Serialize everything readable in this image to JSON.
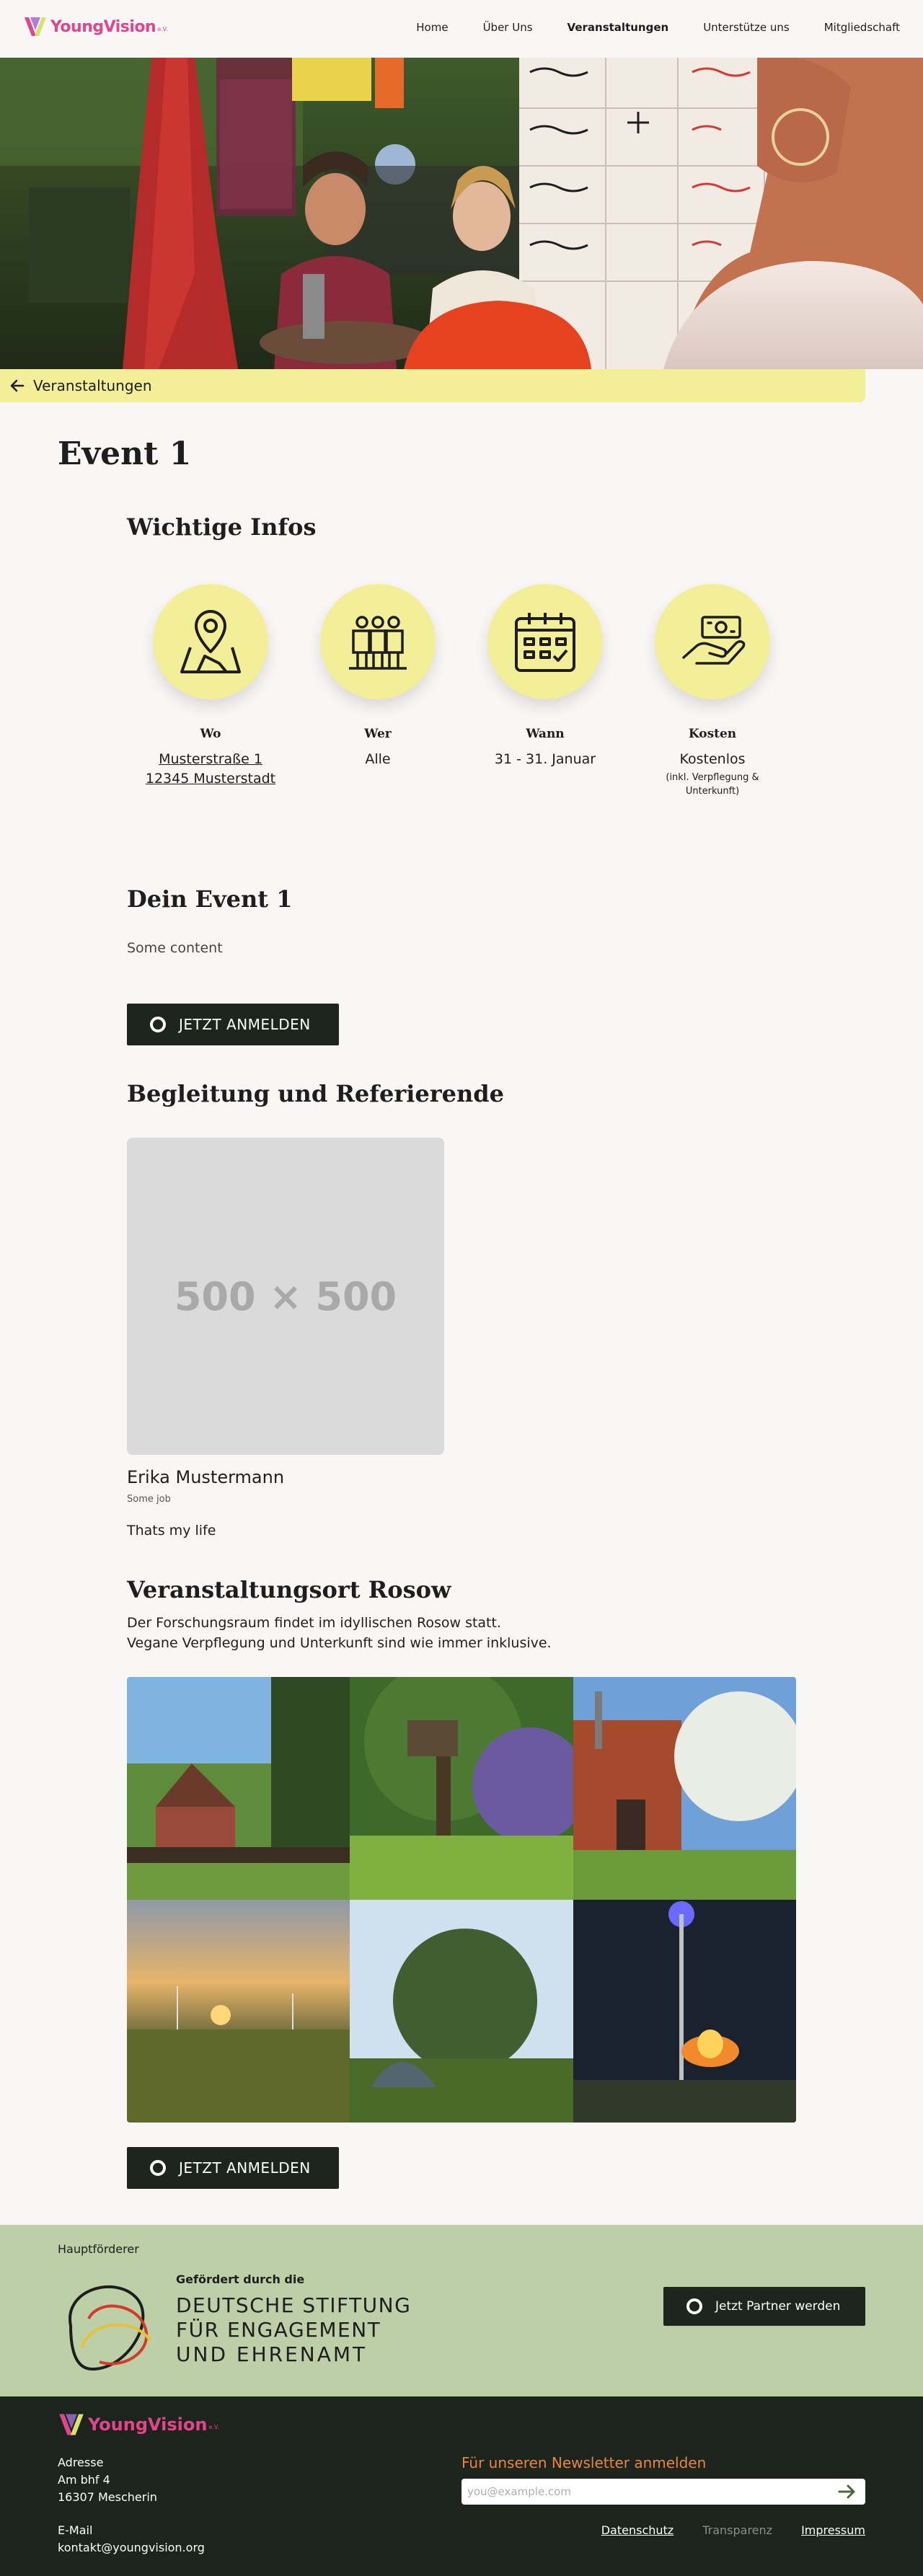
{
  "brand": {
    "name": "YoungVision",
    "suffix": "e.V."
  },
  "nav": {
    "items": [
      {
        "label": "Home"
      },
      {
        "label": "Über Uns"
      },
      {
        "label": "Veranstaltungen",
        "active": true
      },
      {
        "label": "Unterstütze uns"
      },
      {
        "label": "Mitgliedschaft"
      }
    ]
  },
  "back": {
    "label": "Veranstaltungen"
  },
  "page_title": "Event 1",
  "infos": {
    "heading": "Wichtige Infos",
    "items": [
      {
        "icon": "map-pin-icon",
        "title": "Wo",
        "value_line1": "Musterstraße 1",
        "value_line2": "12345 Musterstadt"
      },
      {
        "icon": "people-icon",
        "title": "Wer",
        "value": "Alle"
      },
      {
        "icon": "calendar-icon",
        "title": "Wann",
        "value": "31 - 31. Januar"
      },
      {
        "icon": "money-hand-icon",
        "title": "Kosten",
        "value": "Kostenlos",
        "note_line1": "(inkl. Verpflegung &",
        "note_line2": "Unterkunft)"
      }
    ]
  },
  "event": {
    "heading": "Dein Event 1",
    "content": "Some content"
  },
  "cta": {
    "label": "JETZT ANMELDEN"
  },
  "team": {
    "heading": "Begleitung und Referierende",
    "placeholder": "500 × 500",
    "person": {
      "name": "Erika Mustermann",
      "job": "Some job",
      "bio": "Thats my life"
    }
  },
  "venue": {
    "heading": "Veranstaltungsort Rosow",
    "line1": "Der Forschungsraum findet im idyllischen Rosow statt.",
    "line2": "Vegane Verpflegung und Unterkunft sind wie immer inklusive."
  },
  "sponsor": {
    "caption": "Hauptförderer",
    "small": "Gefördert durch die",
    "line1": "DEUTSCHE STIFTUNG",
    "line2": "FÜR ENGAGEMENT",
    "line3": "UND EHRENAMT",
    "partner_button": "Jetzt Partner werden"
  },
  "footer": {
    "address_label": "Adresse",
    "address_line1": "Am bhf 4",
    "address_line2": "16307 Mescherin",
    "email_label": "E-Mail",
    "email": "kontakt@youngvision.org",
    "newsletter_title": "Für unseren Newsletter anmelden",
    "newsletter_placeholder": "you@example.com",
    "links": [
      {
        "label": "Datenschutz"
      },
      {
        "label": "Transparenz"
      },
      {
        "label": "Impressum"
      }
    ]
  },
  "colors": {
    "accent_yellow": "#f3ef98",
    "dark": "#1e241e",
    "sponsor_green": "#bccfa6",
    "brand_pink": "#e2458c",
    "newsletter_orange": "#e8873c"
  }
}
